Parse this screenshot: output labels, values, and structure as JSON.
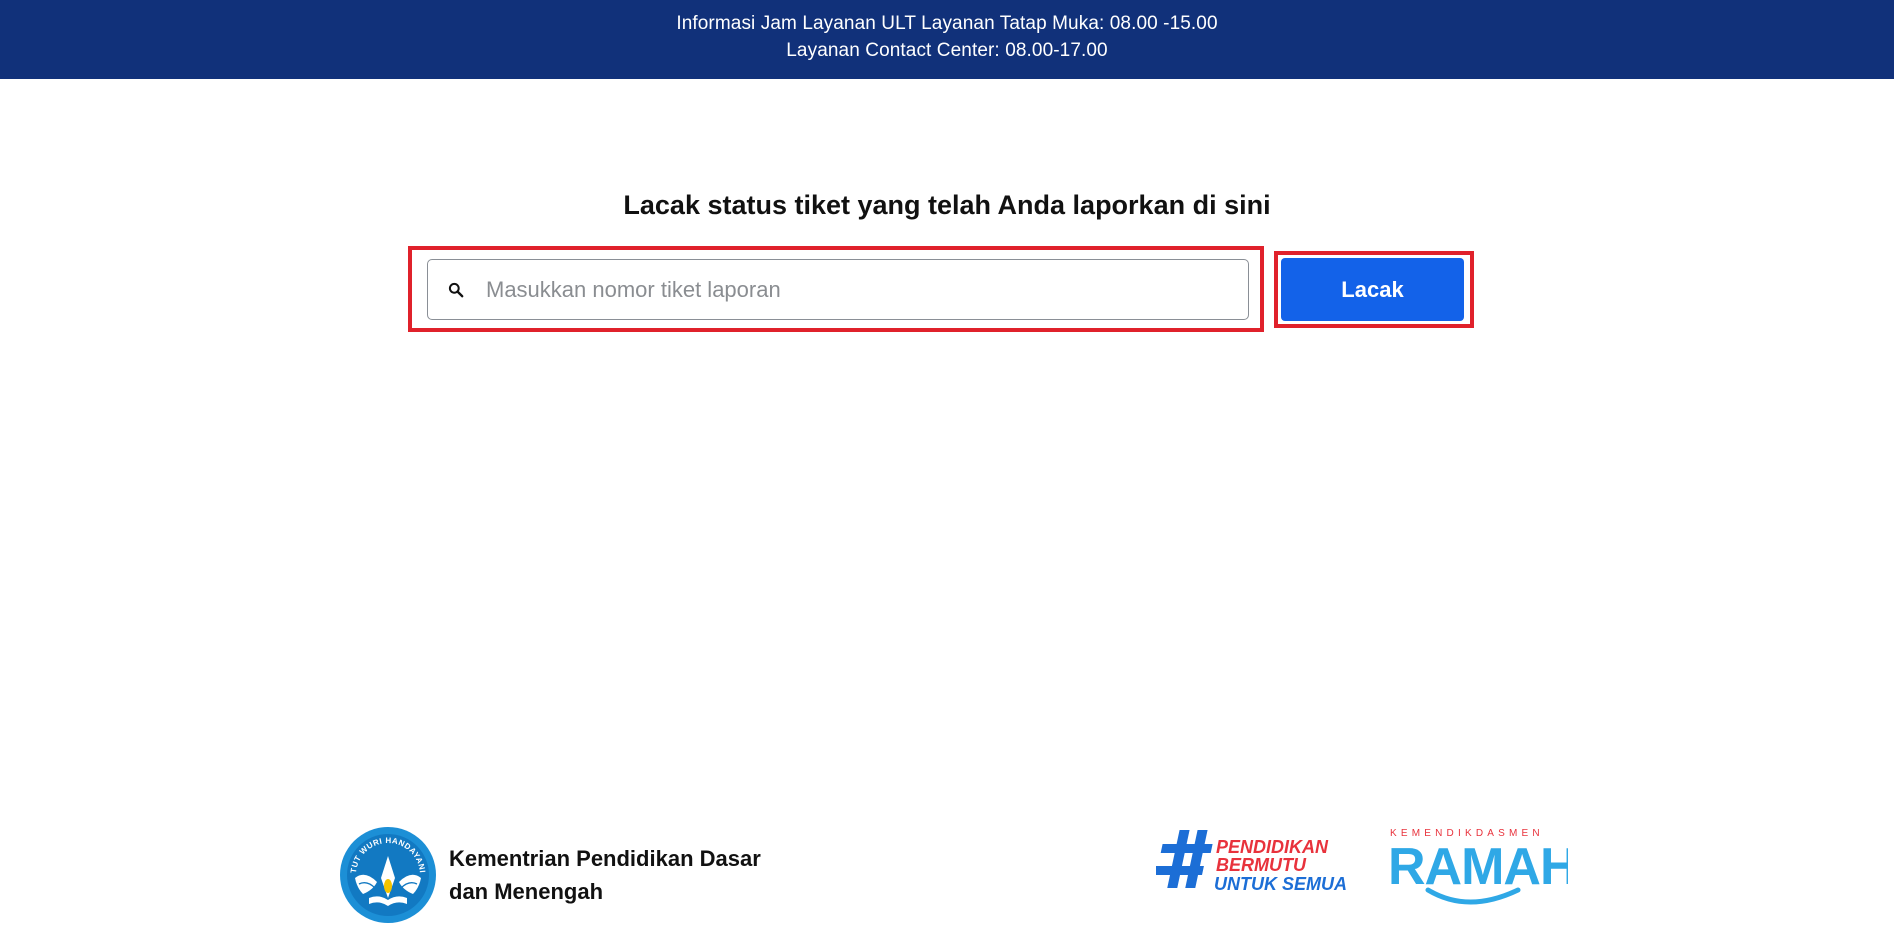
{
  "banner": {
    "line1": "Informasi Jam Layanan ULT Layanan Tatap Muka: 08.00 -15.00",
    "line2": "Layanan Contact Center: 08.00-17.00",
    "color": "#11317a"
  },
  "main": {
    "title": "Lacak status tiket yang telah Anda laporkan di sini",
    "search": {
      "placeholder": "Masukkan nomor tiket laporan",
      "value": "",
      "icon": "search-icon"
    },
    "track_button": {
      "label": "Lacak",
      "color": "#1362e9"
    },
    "highlight_color": "#e0212b"
  },
  "footer": {
    "ministry": {
      "name_line1": "Kementrian Pendidikan Dasar",
      "name_line2": "dan Menengah",
      "logo_text": "TUT WURI HANDAYANI"
    },
    "campaign": {
      "line1": "PENDIDIKAN",
      "line2": "BERMUTU",
      "line3": "UNTUK SEMUA"
    },
    "ramah": {
      "top": "KEMENDIKDASMEN",
      "word": "RAMAH"
    }
  }
}
